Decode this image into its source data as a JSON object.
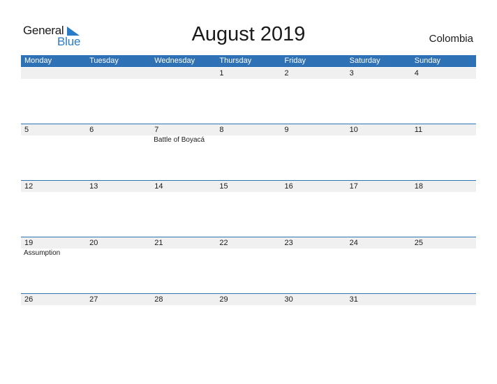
{
  "logo": {
    "word1": "General",
    "word2": "Blue"
  },
  "title": "August 2019",
  "country": "Colombia",
  "colors": {
    "header": "#2e71b4",
    "logo_blue": "#2a7bc8",
    "band": "#f0f0f0"
  },
  "weekdays": [
    "Monday",
    "Tuesday",
    "Wednesday",
    "Thursday",
    "Friday",
    "Saturday",
    "Sunday"
  ],
  "weeks": [
    {
      "days": [
        {
          "num": "",
          "holiday": ""
        },
        {
          "num": "",
          "holiday": ""
        },
        {
          "num": "",
          "holiday": ""
        },
        {
          "num": "1",
          "holiday": ""
        },
        {
          "num": "2",
          "holiday": ""
        },
        {
          "num": "3",
          "holiday": ""
        },
        {
          "num": "4",
          "holiday": ""
        }
      ]
    },
    {
      "days": [
        {
          "num": "5",
          "holiday": ""
        },
        {
          "num": "6",
          "holiday": ""
        },
        {
          "num": "7",
          "holiday": "Battle of Boyacá"
        },
        {
          "num": "8",
          "holiday": ""
        },
        {
          "num": "9",
          "holiday": ""
        },
        {
          "num": "10",
          "holiday": ""
        },
        {
          "num": "11",
          "holiday": ""
        }
      ]
    },
    {
      "days": [
        {
          "num": "12",
          "holiday": ""
        },
        {
          "num": "13",
          "holiday": ""
        },
        {
          "num": "14",
          "holiday": ""
        },
        {
          "num": "15",
          "holiday": ""
        },
        {
          "num": "16",
          "holiday": ""
        },
        {
          "num": "17",
          "holiday": ""
        },
        {
          "num": "18",
          "holiday": ""
        }
      ]
    },
    {
      "days": [
        {
          "num": "19",
          "holiday": "Assumption"
        },
        {
          "num": "20",
          "holiday": ""
        },
        {
          "num": "21",
          "holiday": ""
        },
        {
          "num": "22",
          "holiday": ""
        },
        {
          "num": "23",
          "holiday": ""
        },
        {
          "num": "24",
          "holiday": ""
        },
        {
          "num": "25",
          "holiday": ""
        }
      ]
    },
    {
      "days": [
        {
          "num": "26",
          "holiday": ""
        },
        {
          "num": "27",
          "holiday": ""
        },
        {
          "num": "28",
          "holiday": ""
        },
        {
          "num": "29",
          "holiday": ""
        },
        {
          "num": "30",
          "holiday": ""
        },
        {
          "num": "31",
          "holiday": ""
        },
        {
          "num": "",
          "holiday": ""
        }
      ]
    }
  ]
}
